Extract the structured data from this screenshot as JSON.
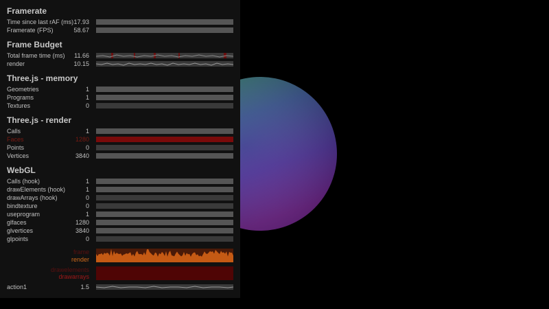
{
  "panel": {
    "framerate": {
      "title": "Framerate",
      "rows": [
        {
          "label": "Time since last rAF (ms)",
          "value": "17.93"
        },
        {
          "label": "Framerate (FPS)",
          "value": "58.67"
        }
      ]
    },
    "frame_budget": {
      "title": "Frame Budget",
      "rows": [
        {
          "label": "Total frame time (ms)",
          "value": "11.66"
        },
        {
          "label": "render",
          "value": "10.15"
        }
      ]
    },
    "memory": {
      "title": "Three.js - memory",
      "rows": [
        {
          "label": "Geometries",
          "value": "1"
        },
        {
          "label": "Programs",
          "value": "1"
        },
        {
          "label": "Textures",
          "value": "0"
        }
      ]
    },
    "render": {
      "title": "Three.js - render",
      "rows": [
        {
          "label": "Calls",
          "value": "1"
        },
        {
          "label": "Faces",
          "value": "1280"
        },
        {
          "label": "Points",
          "value": "0"
        },
        {
          "label": "Vertices",
          "value": "3840"
        }
      ]
    },
    "webgl": {
      "title": "WebGL",
      "rows": [
        {
          "label": "Calls (hook)",
          "value": "1"
        },
        {
          "label": "drawElements (hook)",
          "value": "1"
        },
        {
          "label": "drawArrays (hook)",
          "value": "0"
        },
        {
          "label": "bindtexture",
          "value": "0"
        },
        {
          "label": "useprogram",
          "value": "1"
        },
        {
          "label": "glfaces",
          "value": "1280"
        },
        {
          "label": "glvertices",
          "value": "3840"
        },
        {
          "label": "glpoints",
          "value": "0"
        }
      ]
    },
    "graphs": {
      "render": {
        "label_faded": "frame",
        "label": "render"
      },
      "drawarrays": {
        "label_faded": "drawelements",
        "label": "drawarrays"
      }
    },
    "action": {
      "label": "action1",
      "value": "1.5"
    }
  },
  "colors": {
    "panel_bg": "#111111",
    "bar_bg": "#555555",
    "highlight": "#7a0a0a",
    "render_graph": "#c55a14",
    "drawarrays_graph": "#5a0000"
  },
  "scene": {
    "object": "sphere"
  }
}
